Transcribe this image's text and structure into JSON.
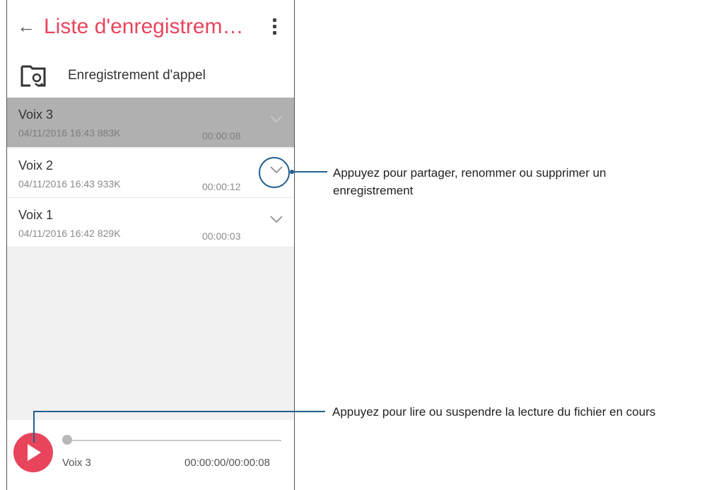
{
  "appbar": {
    "title": "Liste d'enregistrem…"
  },
  "folder": {
    "label": "Enregistrement d'appel"
  },
  "recordings": [
    {
      "name": "Voix 3",
      "meta": "04/11/2016 16:43  883K",
      "duration": "00:00:08",
      "selected": true
    },
    {
      "name": "Voix 2",
      "meta": "04/11/2016 16:43  933K",
      "duration": "00:00:12",
      "selected": false
    },
    {
      "name": "Voix 1",
      "meta": "04/11/2016 16:42  829K",
      "duration": "00:00:03",
      "selected": false
    }
  ],
  "player": {
    "now_playing": "Voix 3",
    "time": "00:00:00/00:00:08",
    "progress": 0
  },
  "annotations": {
    "expand": "Appuyez pour partager, renommer ou supprimer un enregistrement",
    "play": "Appuyez pour lire ou suspendre la lecture du fichier en cours"
  },
  "colors": {
    "accent": "#e8455d",
    "callout": "#1f5e8c",
    "selected_row": "#b0b0b0"
  },
  "icons": {
    "back": "arrow-left-icon",
    "menu": "more-vert-icon",
    "folder": "call-recording-folder-icon",
    "expand": "chevron-down-icon",
    "play": "play-icon"
  }
}
